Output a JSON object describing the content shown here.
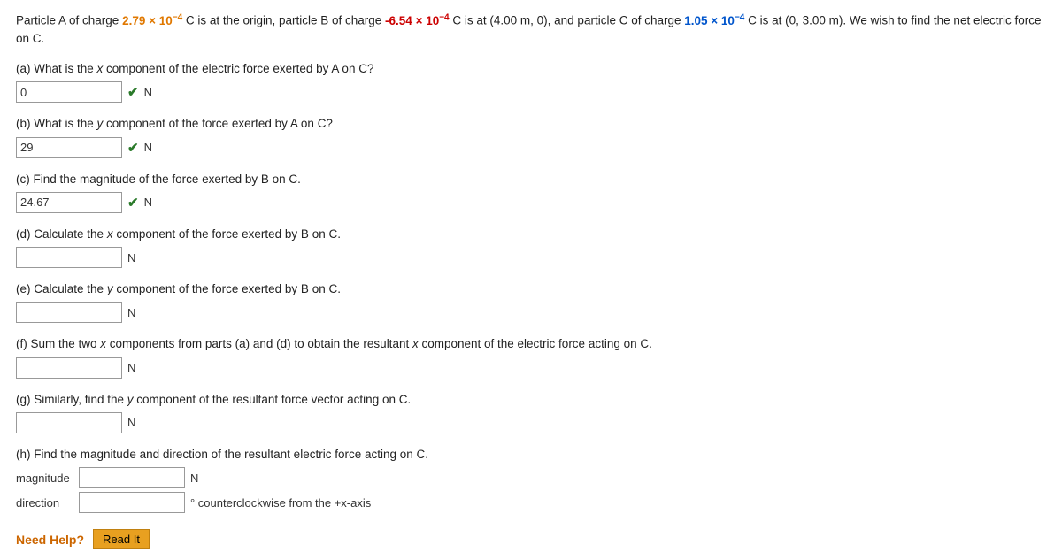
{
  "problem": {
    "statement_parts": {
      "intro": "Particle A of charge ",
      "chargeA": "2.79 × 10",
      "chargeA_exp": "-4",
      "mid1": " C is at the origin, particle B of charge ",
      "chargeB": "-6.54 × 10",
      "chargeB_exp": "-4",
      "mid2": " C is at (4.00 m, 0), and particle C of charge ",
      "chargeC": "1.05 × 10",
      "chargeC_exp": "-4",
      "mid3": " C is at (0, 3.00 m). We wish to find the net electric force on C."
    },
    "parts": [
      {
        "id": "a",
        "label": "(a) What is the x component of the electric force exerted by A on C?",
        "label_italic": "x",
        "value": "0",
        "unit": "N",
        "correct": true
      },
      {
        "id": "b",
        "label": "(b) What is the y component of the force exerted by A on C?",
        "label_italic": "y",
        "value": "29",
        "unit": "N",
        "correct": true
      },
      {
        "id": "c",
        "label": "(c) Find the magnitude of the force exerted by B on C.",
        "value": "24.67",
        "unit": "N",
        "correct": true
      },
      {
        "id": "d",
        "label": "(d) Calculate the x component of the force exerted by B on C.",
        "label_italic": "x",
        "value": "",
        "unit": "N",
        "correct": false
      },
      {
        "id": "e",
        "label": "(e) Calculate the y component of the force exerted by B on C.",
        "label_italic": "y",
        "value": "",
        "unit": "N",
        "correct": false
      },
      {
        "id": "f",
        "label": "(f) Sum the two x components from parts (a) and (d) to obtain the resultant x component of the electric force acting on C.",
        "label_italic": "x",
        "value": "",
        "unit": "N",
        "correct": false
      },
      {
        "id": "g",
        "label": "(g) Similarly, find the y component of the resultant force vector acting on C.",
        "label_italic": "y",
        "value": "",
        "unit": "N",
        "correct": false
      }
    ],
    "part_h": {
      "label": "(h) Find the magnitude and direction of the resultant electric force acting on C.",
      "magnitude_label": "magnitude",
      "magnitude_value": "",
      "magnitude_unit": "N",
      "direction_label": "direction",
      "direction_value": "",
      "direction_unit": "° counterclockwise from the +x-axis"
    }
  },
  "help": {
    "need_help_label": "Need Help?",
    "read_it_label": "Read It"
  }
}
